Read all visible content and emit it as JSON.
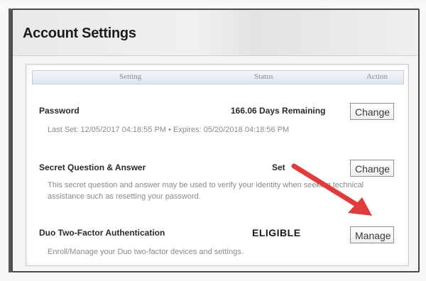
{
  "window": {
    "title": "Account Settings"
  },
  "table": {
    "headers": {
      "setting": "Setting",
      "status": "Status",
      "action": "Action"
    },
    "rows": [
      {
        "name": "Password",
        "status": "166.06 Days Remaining",
        "action": "Change",
        "description": "Last Set: 12/05/2017 04:18:55 PM  •  Expires: 05/20/2018 04:18:56 PM"
      },
      {
        "name": "Secret Question & Answer",
        "status": "Set",
        "action": "Change",
        "description_line1": "This secret question and answer may be used to verify your identity when seeking technical",
        "description_line2": "assistance such as resetting your password."
      },
      {
        "name": "Duo Two-Factor Authentication",
        "status": "ELIGIBLE",
        "action": "Manage",
        "description": "Enroll/Manage your Duo two-factor devices and settings."
      }
    ]
  },
  "annotation": {
    "arrow_color": "#e23b3b",
    "icon": "red-arrow-icon"
  }
}
